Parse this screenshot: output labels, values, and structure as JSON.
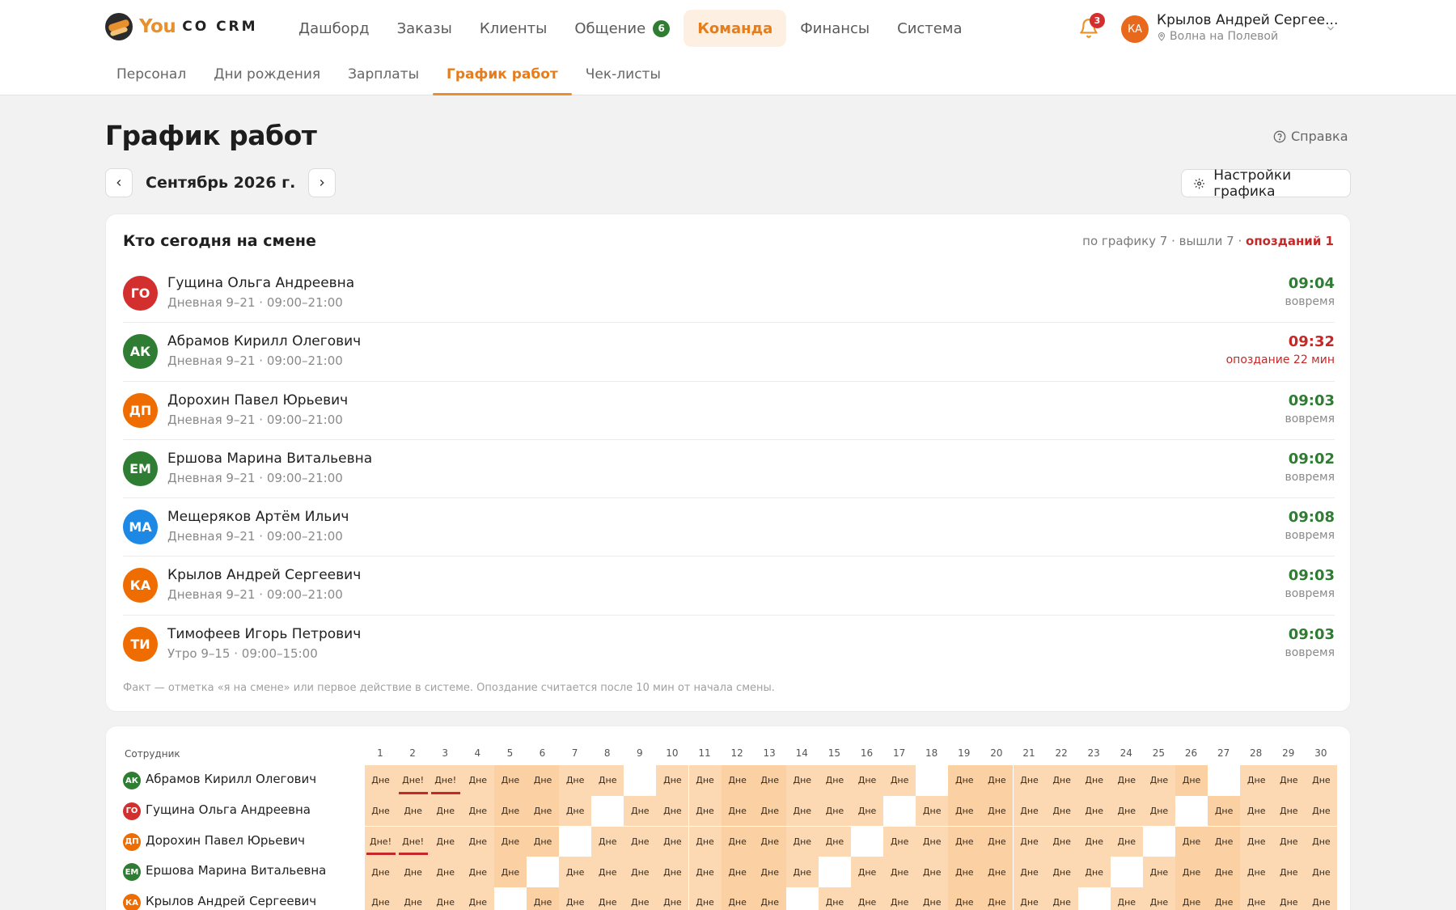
{
  "app": {
    "logo_you": "You",
    "logo_co": "CO CRM"
  },
  "nav": {
    "items": [
      {
        "label": "Дашборд"
      },
      {
        "label": "Заказы"
      },
      {
        "label": "Клиенты"
      },
      {
        "label": "Общение",
        "badge": "6"
      },
      {
        "label": "Команда",
        "active": true
      },
      {
        "label": "Финансы"
      },
      {
        "label": "Система"
      }
    ]
  },
  "notifications": {
    "count": "3",
    "icon": "bell-icon"
  },
  "user": {
    "initials": "КА",
    "name": "Крылов Андрей Сергее...",
    "location": "Волна на Полевой"
  },
  "subnav": {
    "items": [
      {
        "label": "Персонал"
      },
      {
        "label": "Дни рождения"
      },
      {
        "label": "Зарплаты"
      },
      {
        "label": "График работ",
        "active": true
      },
      {
        "label": "Чек-листы"
      }
    ]
  },
  "page": {
    "title": "График работ",
    "help": "Справка",
    "month": "Сентябрь 2026 г.",
    "settings": "Настройки графика"
  },
  "today": {
    "title": "Кто сегодня на смене",
    "stats_prefix": "по графику 7 · вышли 7 · ",
    "stats_late": "опозданий 1",
    "note": "Факт — отметка «я на смене» или первое действие в системе. Опоздание считается после 10 мин от начала смены.",
    "rows": [
      {
        "initials": "ГО",
        "color": "#d32f2f",
        "name": "Гущина Ольга Андреевна",
        "shift": "Дневная 9–21 · 09:00–21:00",
        "time": "09:04",
        "status": "вовремя",
        "late": false
      },
      {
        "initials": "АК",
        "color": "#2e7d32",
        "name": "Абрамов Кирилл Олегович",
        "shift": "Дневная 9–21 · 09:00–21:00",
        "time": "09:32",
        "status": "опоздание 22 мин",
        "late": true
      },
      {
        "initials": "ДП",
        "color": "#ef6c00",
        "name": "Дорохин Павел Юрьевич",
        "shift": "Дневная 9–21 · 09:00–21:00",
        "time": "09:03",
        "status": "вовремя",
        "late": false
      },
      {
        "initials": "ЕМ",
        "color": "#2e7d32",
        "name": "Ершова Марина Витальевна",
        "shift": "Дневная 9–21 · 09:00–21:00",
        "time": "09:02",
        "status": "вовремя",
        "late": false
      },
      {
        "initials": "МА",
        "color": "#1e88e5",
        "name": "Мещеряков Артём Ильич",
        "shift": "Дневная 9–21 · 09:00–21:00",
        "time": "09:08",
        "status": "вовремя",
        "late": false
      },
      {
        "initials": "КА",
        "color": "#ef6c00",
        "name": "Крылов Андрей Сергеевич",
        "shift": "Дневная 9–21 · 09:00–21:00",
        "time": "09:03",
        "status": "вовремя",
        "late": false
      },
      {
        "initials": "ТИ",
        "color": "#ef6c00",
        "name": "Тимофеев Игорь Петрович",
        "shift": "Утро 9–15 · 09:00–15:00",
        "time": "09:03",
        "status": "вовремя",
        "late": false
      }
    ]
  },
  "schedule": {
    "header_label": "Сотрудник",
    "days": [
      "1",
      "2",
      "3",
      "4",
      "5",
      "6",
      "7",
      "8",
      "9",
      "10",
      "11",
      "12",
      "13",
      "14",
      "15",
      "16",
      "17",
      "18",
      "19",
      "20",
      "21",
      "22",
      "23",
      "24",
      "25",
      "26",
      "27",
      "28",
      "29",
      "30"
    ],
    "rows": [
      {
        "initials": "АК",
        "color": "#2e7d32",
        "name": "Абрамов Кирилл Олегович",
        "cells": [
          "Дне",
          "Дне!",
          "Дне!",
          "Дне",
          "Дне",
          "Дне",
          "Дне",
          "Дне",
          "",
          "Дне",
          "Дне",
          "Дне",
          "Дне",
          "Дне",
          "Дне",
          "Дне",
          "Дне",
          "",
          "Дне",
          "Дне",
          "Дне",
          "Дне",
          "Дне",
          "Дне",
          "Дне",
          "Дне",
          "",
          "Дне",
          "Дне",
          "Дне"
        ]
      },
      {
        "initials": "ГО",
        "color": "#d32f2f",
        "name": "Гущина Ольга Андреевна",
        "cells": [
          "Дне",
          "Дне",
          "Дне",
          "Дне",
          "Дне",
          "Дне",
          "Дне",
          "",
          "Дне",
          "Дне",
          "Дне",
          "Дне",
          "Дне",
          "Дне",
          "Дне",
          "Дне",
          "",
          "Дне",
          "Дне",
          "Дне",
          "Дне",
          "Дне",
          "Дне",
          "Дне",
          "Дне",
          "",
          "Дне",
          "Дне",
          "Дне",
          "Дне"
        ]
      },
      {
        "initials": "ДП",
        "color": "#ef6c00",
        "name": "Дорохин Павел Юрьевич",
        "cells": [
          "Дне!",
          "Дне!",
          "Дне",
          "Дне",
          "Дне",
          "Дне",
          "",
          "Дне",
          "Дне",
          "Дне",
          "Дне",
          "Дне",
          "Дне",
          "Дне",
          "Дне",
          "",
          "Дне",
          "Дне",
          "Дне",
          "Дне",
          "Дне",
          "Дне",
          "Дне",
          "Дне",
          "",
          "Дне",
          "Дне",
          "Дне",
          "Дне",
          "Дне"
        ]
      },
      {
        "initials": "ЕМ",
        "color": "#2e7d32",
        "name": "Ершова Марина Витальевна",
        "cells": [
          "Дне",
          "Дне",
          "Дне",
          "Дне",
          "Дне",
          "",
          "Дне",
          "Дне",
          "Дне",
          "Дне",
          "Дне",
          "Дне",
          "Дне",
          "Дне",
          "",
          "Дне",
          "Дне",
          "Дне",
          "Дне",
          "Дне",
          "Дне",
          "Дне",
          "Дне",
          "",
          "Дне",
          "Дне",
          "Дне",
          "Дне",
          "Дне",
          "Дне"
        ]
      },
      {
        "initials": "КА",
        "color": "#ef6c00",
        "name": "Крылов Андрей Сергеевич",
        "cells": [
          "Дне",
          "Дне",
          "Дне",
          "Дне",
          "",
          "Дне",
          "Дне",
          "Дне",
          "Дне",
          "Дне",
          "Дне",
          "Дне",
          "Дне",
          "",
          "Дне",
          "Дне",
          "Дне",
          "Дне",
          "Дне",
          "Дне",
          "Дне",
          "Дне",
          "",
          "Дне",
          "Дне",
          "Дне",
          "Дне",
          "Дне",
          "Дне",
          "Дне"
        ]
      }
    ]
  }
}
